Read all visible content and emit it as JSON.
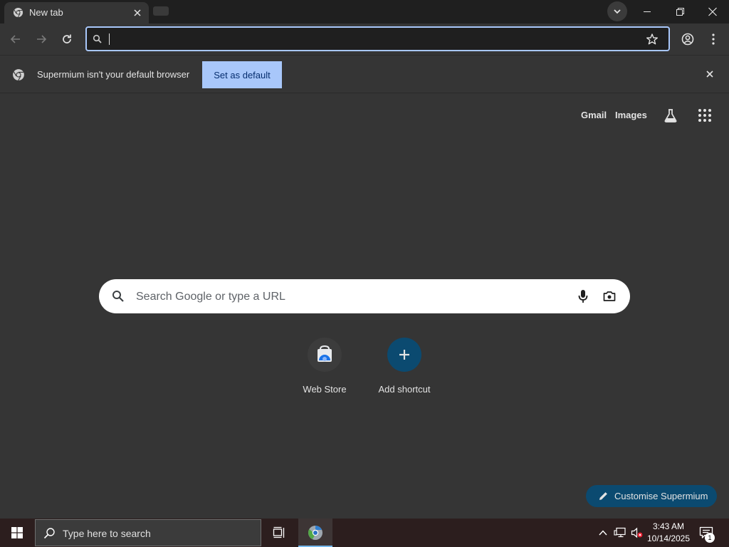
{
  "tab": {
    "title": "New tab"
  },
  "omnibox": {
    "value": ""
  },
  "infobar": {
    "message": "Supermium isn't your default browser",
    "button_label": "Set as default"
  },
  "ntp": {
    "links": {
      "gmail": "Gmail",
      "images": "Images"
    },
    "search_placeholder": "Search Google or type a URL",
    "shortcuts": [
      {
        "label": "Web Store"
      },
      {
        "label": "Add shortcut"
      }
    ],
    "customise_label": "Customise Supermium"
  },
  "taskbar": {
    "search_placeholder": "Type here to search",
    "time": "3:43 AM",
    "date": "10/14/2025",
    "notification_count": "1"
  },
  "colors": {
    "accent": "#a8c7fa",
    "customise_bg": "#0b4a70",
    "page_bg": "#353535"
  },
  "icons": [
    "chrome-icon",
    "close-icon",
    "back-icon",
    "forward-icon",
    "reload-icon",
    "search-icon",
    "star-icon",
    "profile-icon",
    "menu-icon",
    "labs-icon",
    "apps-icon",
    "mic-icon",
    "camera-icon",
    "webstore-icon",
    "plus-icon",
    "pencil-icon",
    "windows-icon",
    "taskview-icon",
    "chevron-up-icon",
    "network-icon",
    "volume-muted-icon",
    "notification-icon"
  ]
}
